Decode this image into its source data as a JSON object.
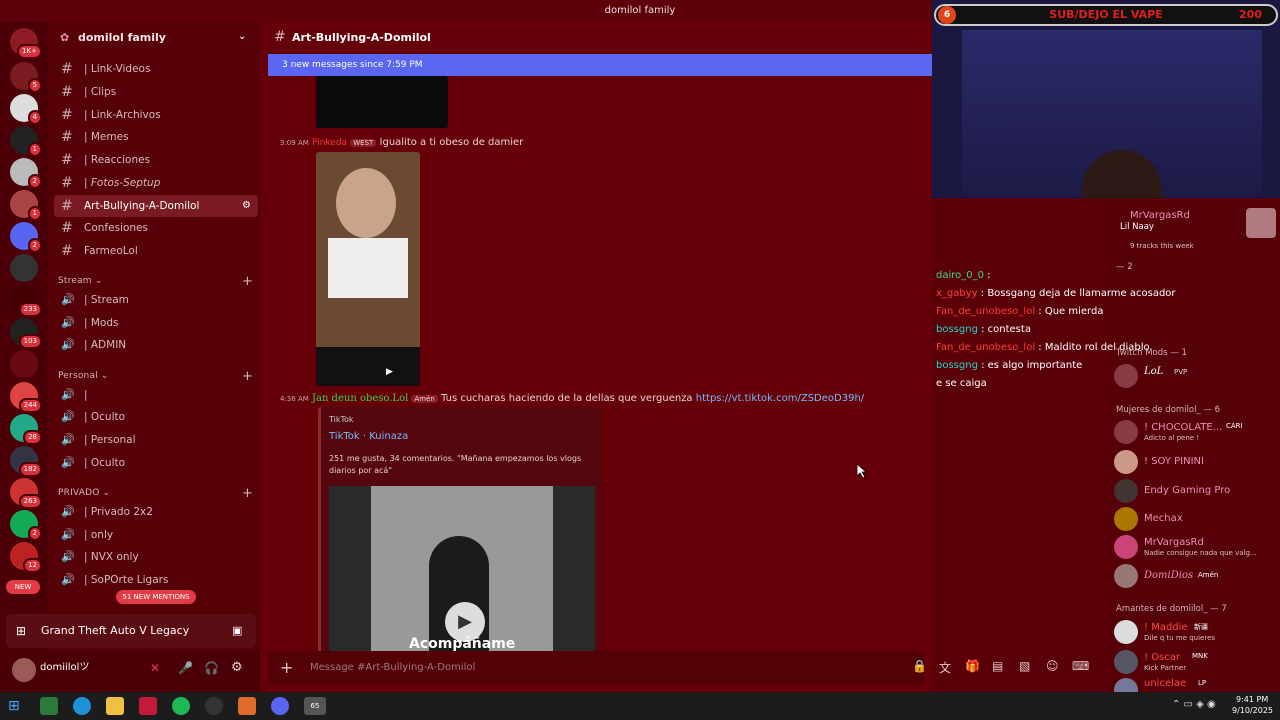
{
  "window": {
    "title": "domilol family"
  },
  "servers": {
    "badges": [
      "1K+",
      "5",
      "4",
      "1",
      "2",
      "1",
      "2",
      "233",
      "103",
      "244",
      "28",
      "182",
      "263",
      "2",
      "12"
    ],
    "new_label": "NEW"
  },
  "sidebar": {
    "server_name": "domilol family",
    "channels": [
      {
        "label": "| Link-Videos"
      },
      {
        "label": "| Clips"
      },
      {
        "label": "| Link-Archivos"
      },
      {
        "label": "| Memes"
      },
      {
        "label": "| Reacciones"
      },
      {
        "label": "| Fotos-Septup"
      },
      {
        "label": "Art-Bullying-A-Domilol"
      },
      {
        "label": "Confesiones"
      },
      {
        "label": "FarmeoLol"
      }
    ],
    "cat_stream": "Stream",
    "stream_channels": [
      {
        "label": "| Stream"
      },
      {
        "label": "| Mods"
      },
      {
        "label": "| ADMIN"
      }
    ],
    "cat_personal": "Personal",
    "personal_channels": [
      {
        "label": "|"
      },
      {
        "label": "| Oculto"
      },
      {
        "label": "| Personal"
      },
      {
        "label": "| Oculto"
      }
    ],
    "cat_privado": "PRIVADO",
    "privado_channels": [
      {
        "label": "| Privado 2x2"
      },
      {
        "label": "| only"
      },
      {
        "label": "| NVX only"
      },
      {
        "label": "| SoPOrte Ligars"
      }
    ],
    "mentions": "51 NEW MENTIONS",
    "game": "Grand Theft Auto V Legacy",
    "username": "domiilolツ"
  },
  "main": {
    "channel_title": "Art-Bullying-A-Domilol",
    "new_messages": "3 new messages since 7:59 PM",
    "msg1": {
      "time": "3:09 AM",
      "author": "Pinkeda",
      "tag": "WEST",
      "text": "Igualito a ti obeso de damier"
    },
    "msg2": {
      "time": "4:36 AM",
      "author": "Jan deun obeso.Lol",
      "tag": "Amén",
      "text": "Tus cucharas haciendo de la dellas que verguenza",
      "link": "https://vt.tiktok.com/ZSDeoD39h/"
    },
    "embed": {
      "provider": "TikTok",
      "title": "TikTok · Kuinaza",
      "desc": "251 me gusta, 34 comentarios. \"Mañana empezamos los vlogs diarios por acá\"",
      "video_caption": "Acompáñame"
    },
    "composer_placeholder": "Message #Art-Bullying-A-Domilol"
  },
  "stream": {
    "banner": "SUB/DEJO EL VAPE",
    "left_count": "6",
    "right_count": "200",
    "chat": [
      {
        "user": "dairo_0_0",
        "text": "",
        "color": "#3ddc84"
      },
      {
        "user": "x_gabyy",
        "text": "Bossgang deja de llamarme acosador",
        "color": "#ff4040"
      },
      {
        "user": "Fan_de_unobeso_lol",
        "text": "Que mierda",
        "color": "#ff3b3b"
      },
      {
        "user": "bossgng",
        "text": "contesta",
        "color": "#29d3c8"
      },
      {
        "user": "Fan_de_unobeso_lol",
        "text": "Maldito rol del diablo",
        "color": "#ff3b3b"
      },
      {
        "user": "bossgng",
        "text": "es algo importante",
        "color": "#29d3c8"
      },
      {
        "user": "",
        "text": "e se caiga",
        "color": "#ffffff"
      }
    ]
  },
  "members": {
    "top": {
      "name": "MrVargasRd",
      "activity": "Lil Naay",
      "tracks": "9 tracks this week"
    },
    "misc_cat": "— 2",
    "twitch_mods": "Twitch Mods — 1",
    "lol": "LoL",
    "lol_tag": "PVP",
    "cat_mujeres": "Mujeres de domilol_ — 6",
    "mujeres": [
      {
        "name": "! CHOCOLATE...",
        "sub": "Adicto al pene !",
        "tag": "CARI"
      },
      {
        "name": "! SOY PININI",
        "sub": ""
      },
      {
        "name": "Endy Gaming Pro",
        "sub": ""
      },
      {
        "name": "Mechax",
        "sub": ""
      },
      {
        "name": "MrVargasRd",
        "sub": "Nadie consigue nada que valg..."
      },
      {
        "name": "DomiDios",
        "sub": "",
        "tag": "Amén"
      }
    ],
    "cat_amantes": "Amantes de domiilol_ — 7",
    "amantes": [
      {
        "name": "! Maddie",
        "sub": "Dile q tu me quieres",
        "tag": "新疆"
      },
      {
        "name": "! Oscar",
        "sub": "Kick Partner",
        "tag": "MNK"
      },
      {
        "name": "unicelae",
        "sub": "",
        "tag": "LP"
      }
    ]
  },
  "taskbar": {
    "time": "9:41 PM",
    "date": "9/10/2025",
    "badge": "65"
  }
}
